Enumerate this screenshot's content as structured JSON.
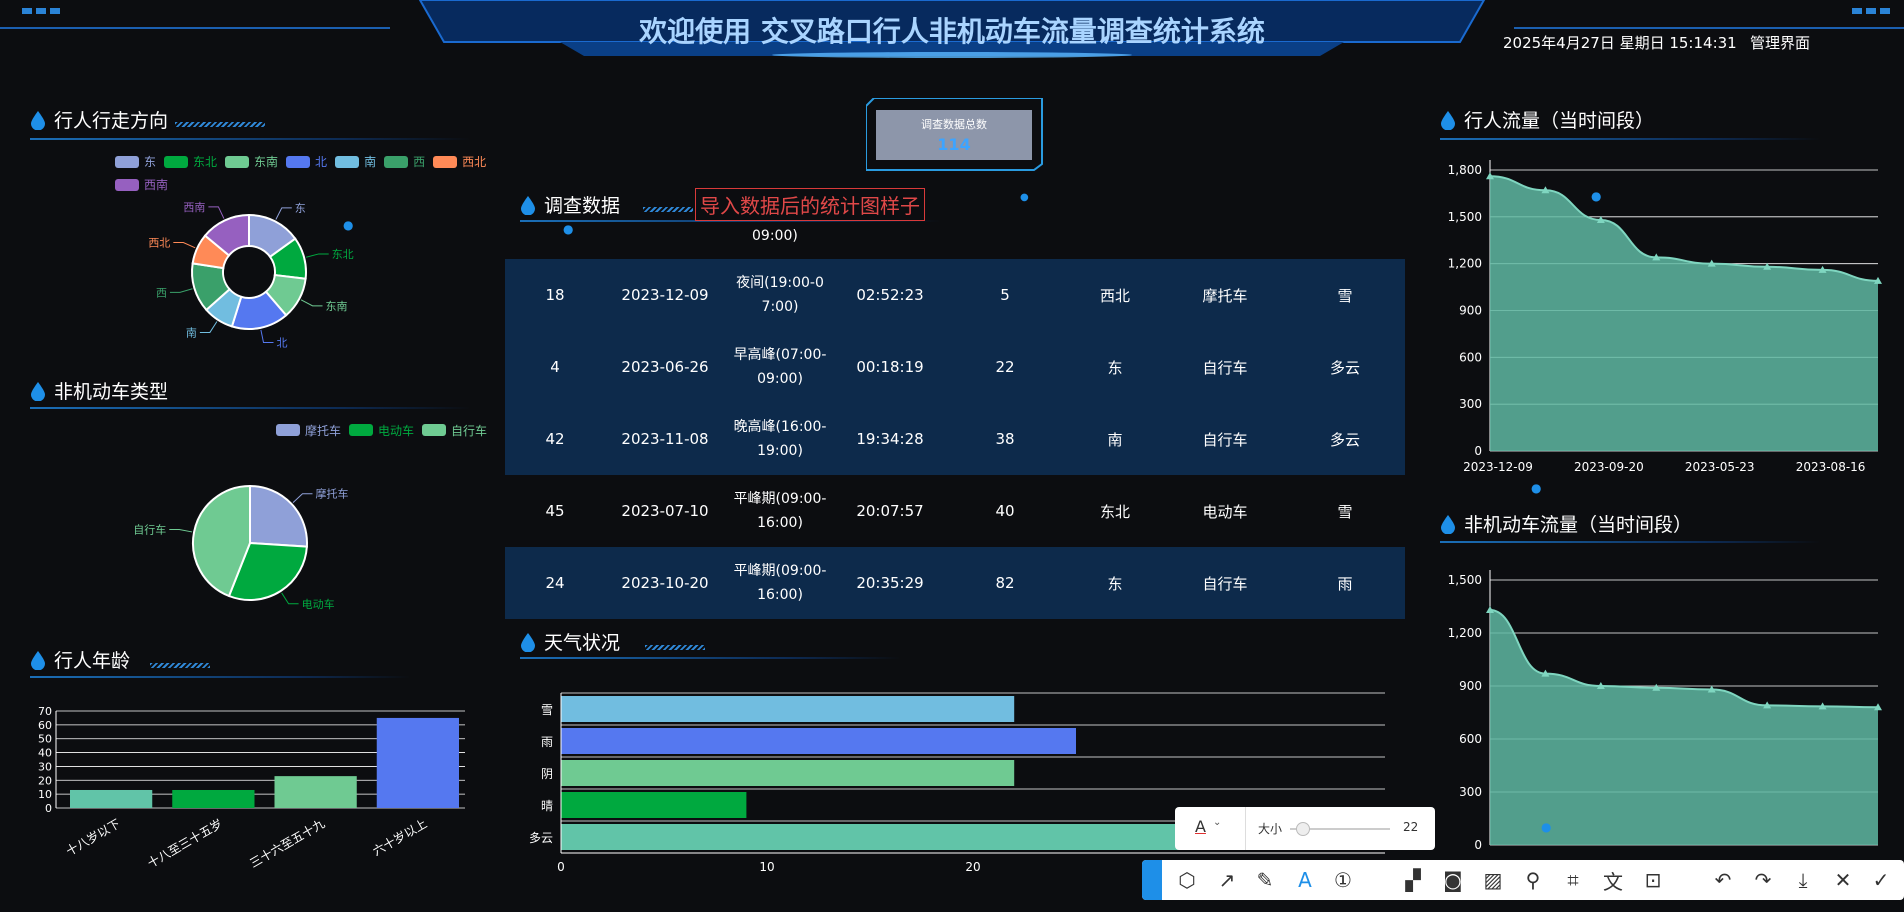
{
  "header": {
    "title": "欢迎使用 交叉路口行人非机动车流量调查统计系统",
    "datetime": "2025年4月27日 星期日 15:14:31",
    "admin_link": "管理界面"
  },
  "sections": {
    "direction": "行人行走方向",
    "vehicle_type": "非机动车类型",
    "age": "行人年龄",
    "survey": "调查数据",
    "weather": "天气状况",
    "ped_flow": "行人流量（当时间段）",
    "veh_flow": "非机动车流量（当时间段）"
  },
  "total": {
    "label": "调查数据总数",
    "value": "114"
  },
  "annotation": "导入数据后的统计图样子",
  "partial_row": "09:00)",
  "table": {
    "rows": [
      [
        "18",
        "2023-12-09",
        "夜间(19:00-0",
        "7:00)",
        "02:52:23",
        "5",
        "西北",
        "摩托车",
        "雪"
      ],
      [
        "4",
        "2023-06-26",
        "早高峰(07:00-",
        "09:00)",
        "00:18:19",
        "22",
        "东",
        "自行车",
        "多云"
      ],
      [
        "42",
        "2023-11-08",
        "晚高峰(16:00-",
        "19:00)",
        "19:34:28",
        "38",
        "南",
        "自行车",
        "多云"
      ],
      [
        "45",
        "2023-07-10",
        "平峰期(09:00-",
        "16:00)",
        "20:07:57",
        "40",
        "东北",
        "电动车",
        "雪"
      ],
      [
        "24",
        "2023-10-20",
        "平峰期(09:00-",
        "16:00)",
        "20:35:29",
        "82",
        "东",
        "自行车",
        "雨"
      ]
    ]
  },
  "colors": {
    "accent": "#1e8fe8",
    "area": "#5fb8a2",
    "title": "#a9d4ff"
  },
  "chart_data": [
    {
      "type": "pie",
      "name": "direction",
      "legend": [
        "东",
        "东北",
        "东南",
        "北",
        "南",
        "西",
        "西北",
        "西南"
      ],
      "categories": [
        "东",
        "东北",
        "东南",
        "北",
        "南",
        "西",
        "西北",
        "西南"
      ],
      "values": [
        14,
        11,
        11,
        15,
        8,
        13,
        8,
        13
      ],
      "colors": [
        "#8fa0d8",
        "#00a93f",
        "#6fca92",
        "#5578f0",
        "#71bde0",
        "#3aa06a",
        "#ff8a57",
        "#9660c0"
      ],
      "donut": true
    },
    {
      "type": "pie",
      "name": "vehicle_type",
      "legend": [
        "摩托车",
        "电动车",
        "自行车"
      ],
      "categories": [
        "摩托车",
        "电动车",
        "自行车"
      ],
      "values": [
        26,
        30,
        44
      ],
      "colors": [
        "#8fa0d8",
        "#00a93f",
        "#6fca92"
      ]
    },
    {
      "type": "bar",
      "name": "age",
      "categories": [
        "十八岁以下",
        "十八至三十五岁",
        "三十六至五十九",
        "六十岁以上"
      ],
      "values": [
        13,
        13,
        23,
        65
      ],
      "ylim": [
        0,
        70
      ],
      "yticks": [
        0,
        10,
        20,
        30,
        40,
        50,
        60,
        70
      ],
      "colors": [
        "#61c4a8",
        "#00a93f",
        "#6fca92",
        "#5578f0"
      ]
    },
    {
      "type": "bar",
      "name": "weather",
      "orientation": "horizontal",
      "categories": [
        "雪",
        "雨",
        "阴",
        "晴",
        "多云"
      ],
      "values": [
        22,
        25,
        22,
        9,
        30
      ],
      "xticks": [
        0,
        10,
        20
      ],
      "colors": [
        "#71bde0",
        "#5578f0",
        "#6fca92",
        "#00a93f",
        "#61c4a8"
      ]
    },
    {
      "type": "area",
      "name": "ped_flow",
      "x_labels": [
        "2023-12-09",
        "2023-09-20",
        "2023-05-23",
        "2023-08-16"
      ],
      "values": [
        1760,
        1670,
        1480,
        1240,
        1200,
        1180,
        1160,
        1090
      ],
      "ylim": [
        0,
        1800
      ],
      "yticks": [
        0,
        300,
        600,
        900,
        "1,200",
        "1,500",
        "1,800"
      ]
    },
    {
      "type": "area",
      "name": "veh_flow",
      "values": [
        1330,
        970,
        900,
        890,
        880,
        790,
        785,
        780
      ],
      "ylim": [
        0,
        1500
      ],
      "yticks": [
        0,
        300,
        600,
        900,
        "1,200",
        "1,500"
      ]
    }
  ],
  "screenshot_toolbar": {
    "size_label": "大小",
    "size_value": "22",
    "font_icon": "A"
  }
}
